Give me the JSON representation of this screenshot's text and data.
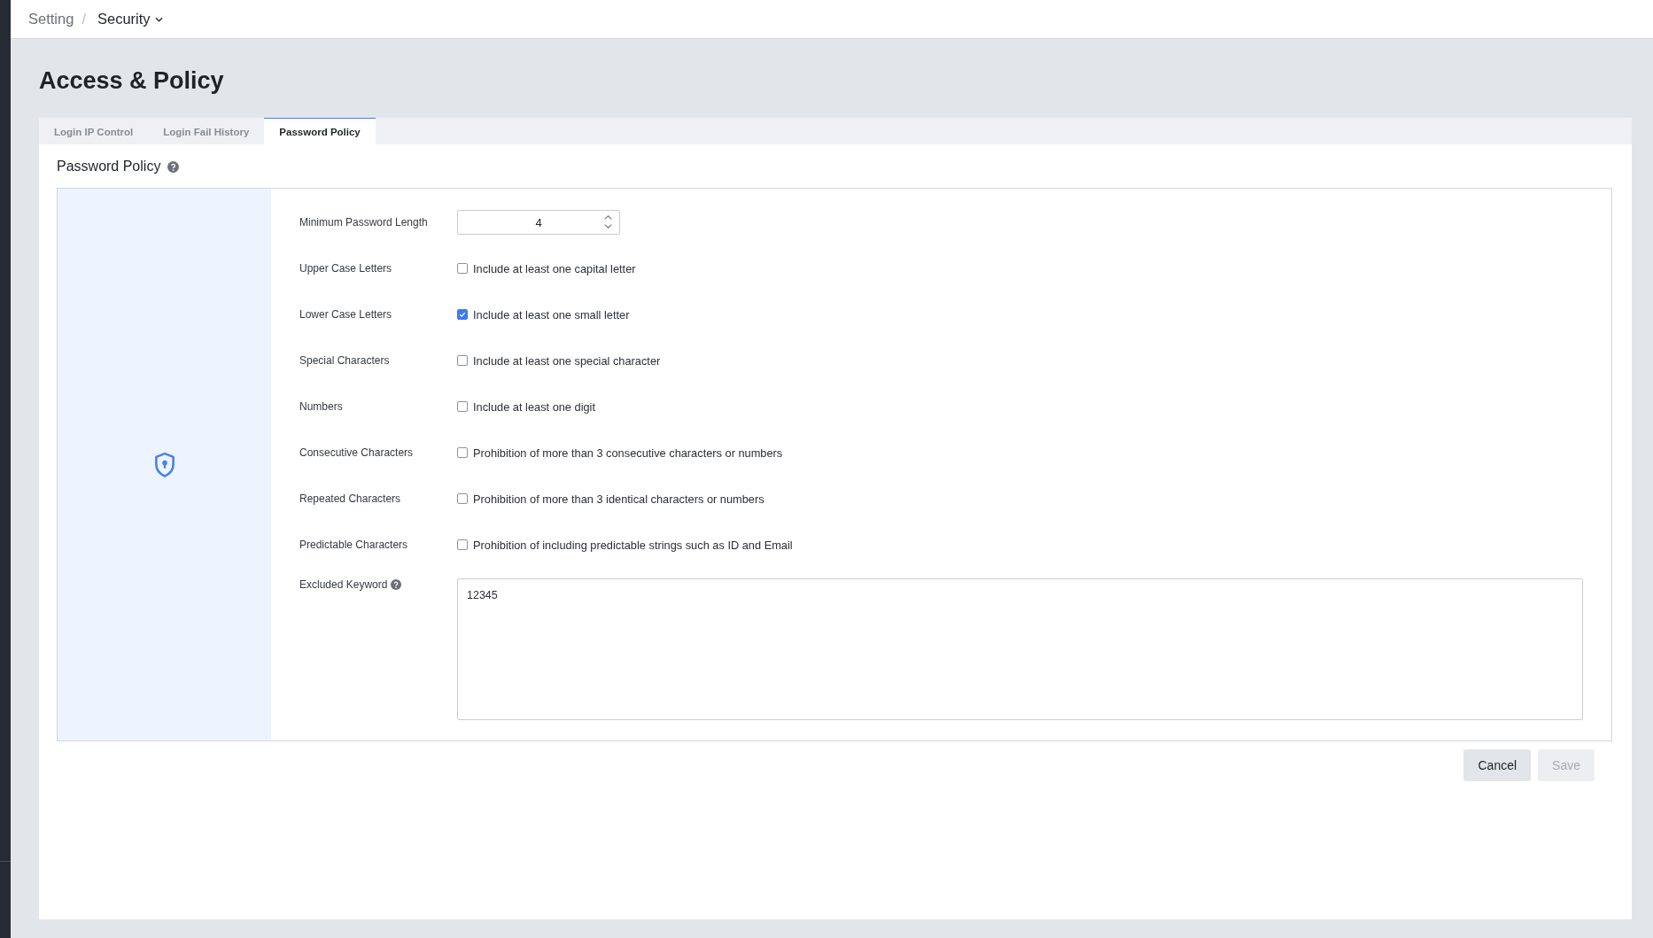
{
  "breadcrumb": {
    "separator": "/",
    "items": [
      {
        "label": "Setting",
        "kind": "link"
      },
      {
        "label": "Security",
        "kind": "dropdown"
      }
    ]
  },
  "page_title": "Access & Policy",
  "tabs": [
    {
      "label": "Login IP Control",
      "selected": false
    },
    {
      "label": "Login Fail History",
      "selected": false
    },
    {
      "label": "Password Policy",
      "selected": true
    }
  ],
  "section": {
    "title": "Password Policy",
    "help": true
  },
  "policy_fields": [
    {
      "kind": "number",
      "label": "Minimum Password Length",
      "value": "4"
    },
    {
      "kind": "checkbox",
      "label": "Upper Case Letters",
      "option": "Include at least one capital letter",
      "checked": false
    },
    {
      "kind": "checkbox",
      "label": "Lower Case Letters",
      "option": "Include at least one small letter",
      "checked": true
    },
    {
      "kind": "checkbox",
      "label": "Special Characters",
      "option": "Include at least one special character",
      "checked": false
    },
    {
      "kind": "checkbox",
      "label": "Numbers",
      "option": "Include at least one digit",
      "checked": false
    },
    {
      "kind": "checkbox",
      "label": "Consecutive Characters",
      "option": "Prohibition of more than 3 consecutive characters or numbers",
      "checked": false
    },
    {
      "kind": "checkbox",
      "label": "Repeated Characters",
      "option": "Prohibition of more than 3 identical characters or numbers",
      "checked": false
    },
    {
      "kind": "checkbox",
      "label": "Predictable Characters",
      "option": "Prohibition of including predictable strings such as ID and Email",
      "checked": false
    },
    {
      "kind": "textarea",
      "label": "Excluded Keyword",
      "value": "12345",
      "help": true
    }
  ],
  "buttons": [
    {
      "label": "Cancel",
      "disabled": false
    },
    {
      "label": "Save",
      "disabled": true
    }
  ]
}
